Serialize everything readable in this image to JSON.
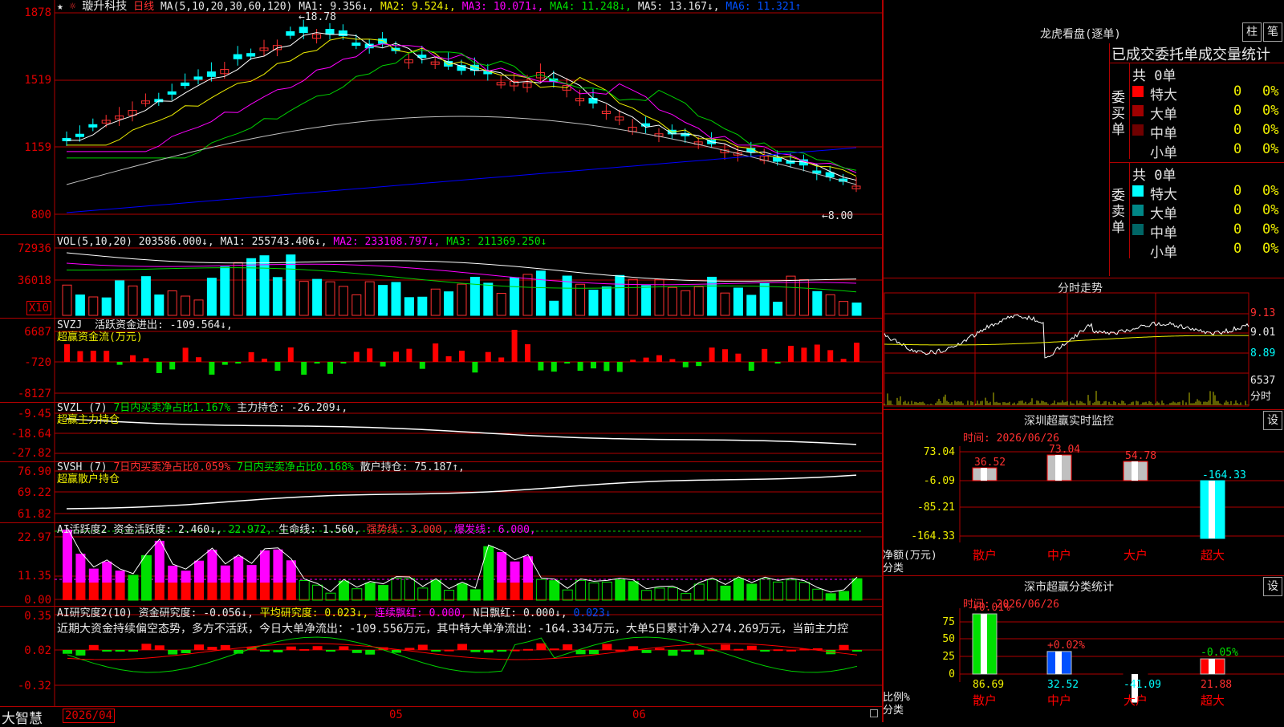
{
  "stock": {
    "star": "★",
    "name": "璇升科技",
    "period": "日线",
    "ma_params": "MA(5,10,20,30,60,120)",
    "ma1": "MA1: 9.356↓,",
    "ma2": "MA2: 9.524↓,",
    "ma3": "MA3: 10.071↓,",
    "ma4": "MA4: 11.248↓,",
    "ma5": "MA5: 13.167↓,",
    "ma6": "MA6: 11.321↑",
    "high_mark": "18.78",
    "low_mark": "←8.00",
    "price_ticks": [
      "1878",
      "1519",
      "1159",
      "800"
    ]
  },
  "vol": {
    "label": "VOL(5,10,20)",
    "val": "203586.000↓,",
    "ma1": "MA1: 255743.406↓,",
    "ma2": "MA2: 233108.797↓,",
    "ma3": "MA3: 211369.250↓",
    "ticks": [
      "72936",
      "36018"
    ],
    "unit": "X10"
  },
  "svzj": {
    "line1a": "SVZJ",
    "line1b": "活跃资金进出: -109.564↓,",
    "line2": "超赢资金流(万元)",
    "ticks": [
      "6687",
      "-720",
      "-8127"
    ]
  },
  "svzl": {
    "a": "SVZL (7)",
    "b": "7日内买卖净占比1.167%",
    "c": "主力持仓: -26.209↓,",
    "line2": "超赢主力持仓",
    "ticks": [
      "-9.45",
      "-18.64",
      "-27.82"
    ]
  },
  "svsh": {
    "a": "SVSH (7)",
    "b": "7日内买卖净占比0.059%",
    "c": "7日内买卖净占比0.168%",
    "d": "散户持仓: 75.187↑,",
    "line2": "超赢散户持仓",
    "ticks": [
      "76.90",
      "69.22",
      "61.82"
    ]
  },
  "ai1": {
    "a": "AI活跃度2",
    "b": "资金活跃度: 2.460↓,",
    "c": "22.972,",
    "d": "生命线: 1.560,",
    "e": "强势线: 3.000,",
    "f": "爆发线: 6.000,",
    "ticks": [
      "22.97",
      "11.35",
      "0.00"
    ]
  },
  "ai2": {
    "a": "AI研究度2(10)",
    "b": "资金研究度: -0.056↓,",
    "c": "平均研究度: 0.023↓,",
    "d": "连续飘红: 0.000,",
    "e": "N日飘红: 0.000↓,",
    "f": "0.023↓",
    "comment": "近期大资金持续偏空态势，多方不活跃，今日大单净流出：-109.556万元，其中特大单净流出：-164.334万元，大单5日累计净入274.269万元，当前主力控",
    "ticks": [
      "0.35",
      "0.02",
      "-0.32"
    ]
  },
  "bottom": {
    "brand": "大智慧",
    "date": "2026/04",
    "m05": "05",
    "m06": "06"
  },
  "dragon": {
    "title": "龙虎看盘(逐单)",
    "btn1": "柱",
    "btn2": "笔",
    "sub": "已成交委托单成交量统计",
    "buy_label": "委买单",
    "sell_label": "委卖单",
    "buy_total": "共 0单",
    "sell_total": "共 0单",
    "rows": [
      {
        "name": "特大",
        "count": "0",
        "pct": "0%"
      },
      {
        "name": "大单",
        "count": "0",
        "pct": "0%"
      },
      {
        "name": "中单",
        "count": "0",
        "pct": "0%"
      },
      {
        "name": "小单",
        "count": "0",
        "pct": "0%"
      }
    ],
    "buy_colors": [
      "#ff0000",
      "#a00000",
      "#700000",
      "#000000"
    ],
    "sell_colors": [
      "#00ffff",
      "#008888",
      "#006666",
      "#000000"
    ]
  },
  "intraday": {
    "title": "分时走势",
    "ticks": [
      "9.13",
      "9.01",
      "8.89"
    ],
    "vol_tick": "6537",
    "vol_label": "分时"
  },
  "sz_monitor": {
    "title": "深圳超赢实时监控",
    "btn": "设",
    "time": "时间: 2026/06/26",
    "ticks": [
      "73.04",
      "-6.09",
      "-85.21",
      "-164.33"
    ],
    "ylabel1": "净额(万元)",
    "ylabel2": "分类",
    "categories": [
      "散户",
      "中户",
      "大户",
      "超大"
    ],
    "values": [
      36.52,
      73.04,
      54.78,
      -164.33
    ],
    "value_labels": [
      "36.52",
      "73.04",
      "54.78",
      "-164.33"
    ]
  },
  "sz_class": {
    "title": "深市超赢分类统计",
    "btn": "设",
    "time": "时间: 2026/06/26",
    "ticks": [
      "75",
      "50",
      "25",
      "0"
    ],
    "ylabel1": "比例%",
    "ylabel2": "分类",
    "categories": [
      "散户",
      "中户",
      "大户",
      "超大"
    ],
    "values": [
      86.69,
      32.52,
      -41.09,
      21.88
    ],
    "value_labels": [
      "86.69",
      "32.52",
      "-41.09",
      "21.88"
    ],
    "change_labels": [
      "+0.01%",
      "+0.02%",
      "",
      "-0.05%"
    ]
  },
  "colors": {
    "up": "#ff3030",
    "down": "#00ffff",
    "grid": "#b00000"
  }
}
